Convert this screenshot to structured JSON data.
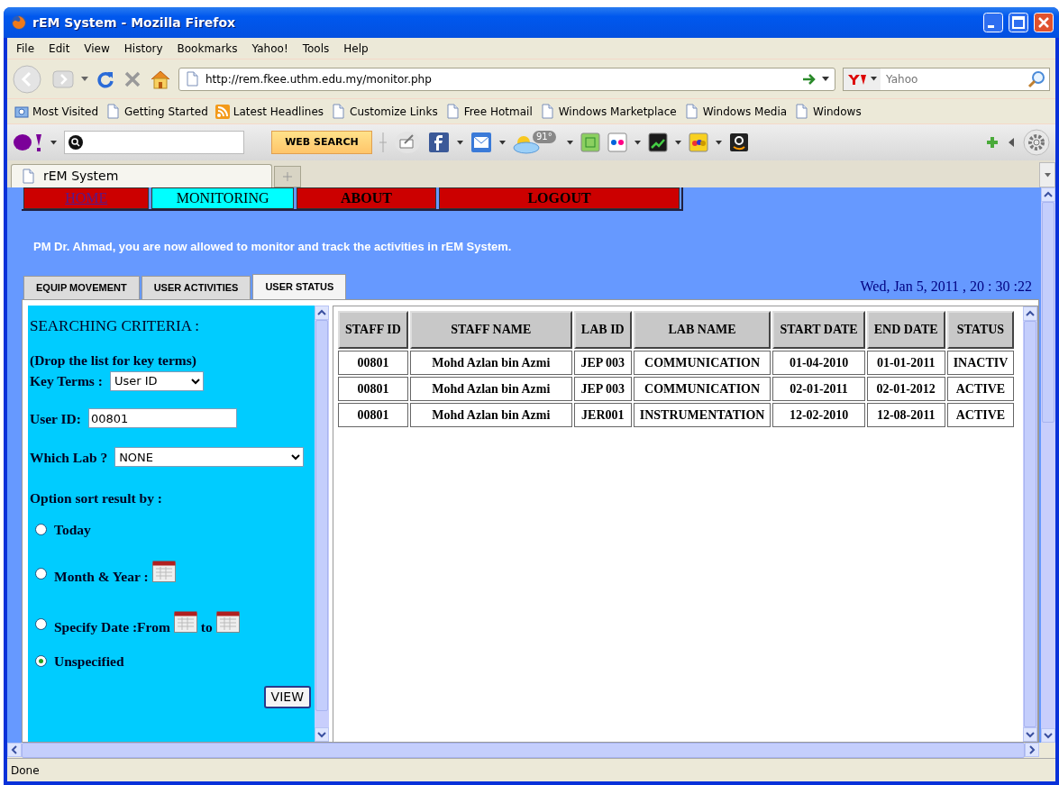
{
  "window": {
    "title": "rEM System - Mozilla Firefox"
  },
  "menu": [
    "File",
    "Edit",
    "View",
    "History",
    "Bookmarks",
    "Yahoo!",
    "Tools",
    "Help"
  ],
  "address": {
    "value": "http://rem.fkee.uthm.edu.my/monitor.php"
  },
  "search": {
    "placeholder": "Yahoo"
  },
  "bookmarks": [
    {
      "label": "Most Visited",
      "kind": "folder"
    },
    {
      "label": "Getting Started",
      "kind": "page"
    },
    {
      "label": "Latest Headlines",
      "kind": "feed"
    },
    {
      "label": "Customize Links",
      "kind": "page"
    },
    {
      "label": "Free Hotmail",
      "kind": "page"
    },
    {
      "label": "Windows Marketplace",
      "kind": "page"
    },
    {
      "label": "Windows Media",
      "kind": "page"
    },
    {
      "label": "Windows",
      "kind": "page"
    }
  ],
  "yahoo_toolbar": {
    "search_button": "WEB SEARCH",
    "weather_badge": "91°"
  },
  "browser_tabs": [
    {
      "label": "rEM System",
      "selected": true
    }
  ],
  "page": {
    "nav": [
      {
        "label": "HOME",
        "selected": false,
        "kind": "link"
      },
      {
        "label": "MONITORING",
        "selected": true,
        "kind": "item"
      },
      {
        "label": "ABOUT",
        "selected": false,
        "kind": "item"
      },
      {
        "label": "LOGOUT",
        "selected": false,
        "kind": "item"
      }
    ],
    "message": "PM Dr. Ahmad, you are now allowed to monitor and track the activities in rEM System.",
    "tabs": [
      {
        "label": "EQUIP MOVEMENT",
        "selected": false
      },
      {
        "label": "USER ACTIVITIES",
        "selected": false
      },
      {
        "label": "USER STATUS",
        "selected": true
      }
    ],
    "datetime": "Wed, Jan 5, 2011 , 20 : 30 :22",
    "criteria": {
      "heading": "SEARCHING CRITERIA :",
      "hint": "(Drop the list for key terms)",
      "key_terms": {
        "label": "Key Terms :",
        "value": "User ID"
      },
      "user_id": {
        "label": "User ID:",
        "value": "00801"
      },
      "which_lab": {
        "label": "Which Lab ?",
        "value": "NONE"
      },
      "sort_label": "Option sort result by :",
      "options": [
        {
          "selected": false,
          "parts": [
            {
              "kind": "text",
              "text": "Today"
            }
          ]
        },
        {
          "selected": false,
          "parts": [
            {
              "kind": "text",
              "text": "Month & Year :"
            },
            {
              "kind": "calendar"
            }
          ]
        },
        {
          "selected": false,
          "parts": [
            {
              "kind": "text",
              "text": "Specify Date :From"
            },
            {
              "kind": "calendar"
            },
            {
              "kind": "text",
              "text": "to"
            },
            {
              "kind": "calendar"
            }
          ]
        },
        {
          "selected": true,
          "parts": [
            {
              "kind": "text",
              "text": "Unspecified"
            }
          ]
        }
      ],
      "view_button": "VIEW"
    },
    "table": {
      "columns": [
        "STAFF ID",
        "STAFF NAME",
        "LAB ID",
        "LAB NAME",
        "START DATE",
        "END DATE",
        "STATUS"
      ],
      "rows": [
        [
          "00801",
          "Mohd Azlan bin Azmi",
          "JEP 003",
          "COMMUNICATION",
          "01-04-2010",
          "01-01-2011",
          "INACTIV"
        ],
        [
          "00801",
          "Mohd Azlan bin Azmi",
          "JEP 003",
          "COMMUNICATION",
          "02-01-2011",
          "02-01-2012",
          "ACTIVE"
        ],
        [
          "00801",
          "Mohd Azlan bin Azmi",
          "JER001",
          "INSTRUMENTATION",
          "12-02-2010",
          "12-08-2011",
          "ACTIVE"
        ]
      ]
    }
  },
  "status_bar": "Done"
}
